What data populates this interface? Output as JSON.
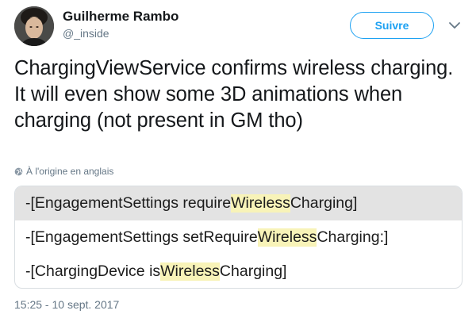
{
  "author": {
    "name": "Guilherme Rambo",
    "handle": "@_inside"
  },
  "follow_button": {
    "label": "Suivre"
  },
  "menu": {
    "icon": "chevron-down-icon"
  },
  "tweet": {
    "text": "ChargingViewService confirms wireless charging. It will even show some 3D animations when charging (not present in GM tho)"
  },
  "translation": {
    "icon": "globe-icon",
    "label": "À l'origine en anglais"
  },
  "media": {
    "lines": [
      {
        "before": "-[EngagementSettings require",
        "highlight": "Wireless",
        "after": "Charging]"
      },
      {
        "before": "-[EngagementSettings setRequire",
        "highlight": "Wireless",
        "after": "Charging:]"
      },
      {
        "before": "-[ChargingDevice is",
        "highlight": "Wireless",
        "after": "Charging]"
      }
    ],
    "highlight_color": "#f8f3b8"
  },
  "timestamp": "15:25 - 10 sept. 2017",
  "colors": {
    "accent": "#1da1f2",
    "secondary_text": "#657786",
    "primary_text": "#14171a"
  }
}
